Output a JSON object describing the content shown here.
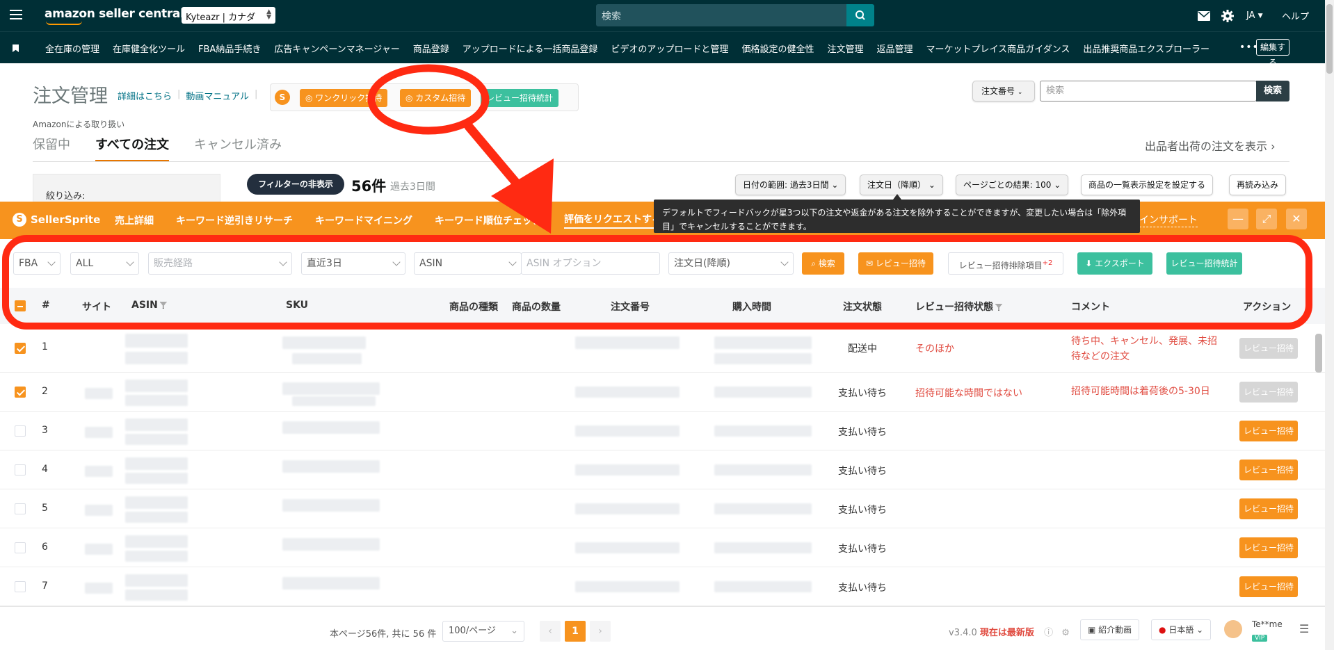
{
  "amazon": {
    "logo": "amazon seller central",
    "store": "Kyteazr | カナダ",
    "search_placeholder": "検索",
    "lang": "JA",
    "help": "ヘルプ",
    "nav": [
      "全在庫の管理",
      "在庫健全化ツール",
      "FBA納品手続き",
      "広告キャンペーンマネージャー",
      "商品登録",
      "アップロードによる一括商品登録",
      "ビデオのアップロードと管理",
      "価格設定の健全性",
      "注文管理",
      "返品管理",
      "マーケットプレイス商品ガイダンス",
      "出品推奨商品エクスプローラー"
    ],
    "nav_more": "•••",
    "edit": "編集する"
  },
  "header": {
    "title": "注文管理",
    "link_details": "詳細はこちら",
    "link_video": "動画マニュアル",
    "ss_one_click": "ワンクリック招待",
    "ss_custom": "カスタム招待",
    "ss_stats": "レビュー招待統計",
    "order_sel": "注文番号",
    "search_placeholder": "検索",
    "search_btn": "検索",
    "fba_note": "Amazonによる取り扱い",
    "tabs": [
      "保留中",
      "すべての注文",
      "キャンセル済み"
    ],
    "show_fbm": "出品者出荷の注文を表示 ›",
    "filter_label": "絞り込み:",
    "hide_filter": "フィルターの非表示",
    "count": "56件",
    "count_sub": "過去3日間",
    "date_range": "日付の範囲: 過去3日間",
    "sort": "注文日（降順）",
    "per_page": "ページごとの結果: 100",
    "display_settings": "商品の一覧表示設定を設定する",
    "reload": "再読み込み"
  },
  "sellersprite": {
    "brand": "SellerSprite",
    "menu": [
      "売上詳細",
      "キーワード逆引きリサーチ",
      "キーワードマイニング",
      "キーワード順位チェック",
      "評価をリクエストする"
    ],
    "support": "インサポート",
    "tooltip": "デフォルトでフィードバックが星3つ以下の注文や返金がある注文を除外することができますが、変更したい場合は「除外項目」でキャンセルすることができます。"
  },
  "filters": {
    "fulfillment": "FBA",
    "all": "ALL",
    "channel_placeholder": "販売経路",
    "period": "直近3日",
    "id_type": "ASIN",
    "asin_placeholder": "ASIN オプション",
    "sort": "注文日(降順)",
    "search": "検索",
    "review_invite": "レビュー招待",
    "exclude": "レビュー招待排除項目",
    "exclude_count": "+2",
    "export": "エクスポート",
    "stats": "レビュー招待統計"
  },
  "table": {
    "headers": [
      "#",
      "サイト",
      "ASIN",
      "SKU",
      "商品の種類",
      "商品の数量",
      "注文番号",
      "購入時間",
      "注文状態",
      "レビュー招待状態",
      "コメント",
      "アクション"
    ],
    "rows": [
      {
        "idx": "1",
        "status": "配送中",
        "review_state": "そのほか",
        "comment": "待ち中、キャンセル、発展、未招待などの注文",
        "action": "レビュー招待",
        "checked": true,
        "disabled": true
      },
      {
        "idx": "2",
        "status": "支払い待ち",
        "review_state": "招待可能な時間ではない",
        "comment": "招待可能時間は着荷後の5-30日",
        "action": "レビュー招待",
        "checked": true,
        "disabled": true
      },
      {
        "idx": "3",
        "status": "支払い待ち",
        "review_state": "",
        "comment": "",
        "action": "レビュー招待",
        "checked": false,
        "disabled": false
      },
      {
        "idx": "4",
        "status": "支払い待ち",
        "review_state": "",
        "comment": "",
        "action": "レビュー招待",
        "checked": false,
        "disabled": false
      },
      {
        "idx": "5",
        "status": "支払い待ち",
        "review_state": "",
        "comment": "",
        "action": "レビュー招待",
        "checked": false,
        "disabled": false
      },
      {
        "idx": "6",
        "status": "支払い待ち",
        "review_state": "",
        "comment": "",
        "action": "レビュー招待",
        "checked": false,
        "disabled": false
      },
      {
        "idx": "7",
        "status": "支払い待ち",
        "review_state": "",
        "comment": "",
        "action": "レビュー招待",
        "checked": false,
        "disabled": false
      }
    ]
  },
  "footer": {
    "page_info": "本ページ56件, 共に 56 件",
    "page_size": "100/ページ",
    "current_page": "1",
    "version": "v3.4.0",
    "latest": "現在は最新版",
    "intro_video": "紹介動画",
    "language": "日本語",
    "user": "Te**me",
    "vip": "VIP"
  },
  "colors": {
    "amazon_bar": "#002f36",
    "sellersprite_orange": "#f7931e",
    "annotation_red": "#ff2a12",
    "green": "#3cc09e"
  }
}
